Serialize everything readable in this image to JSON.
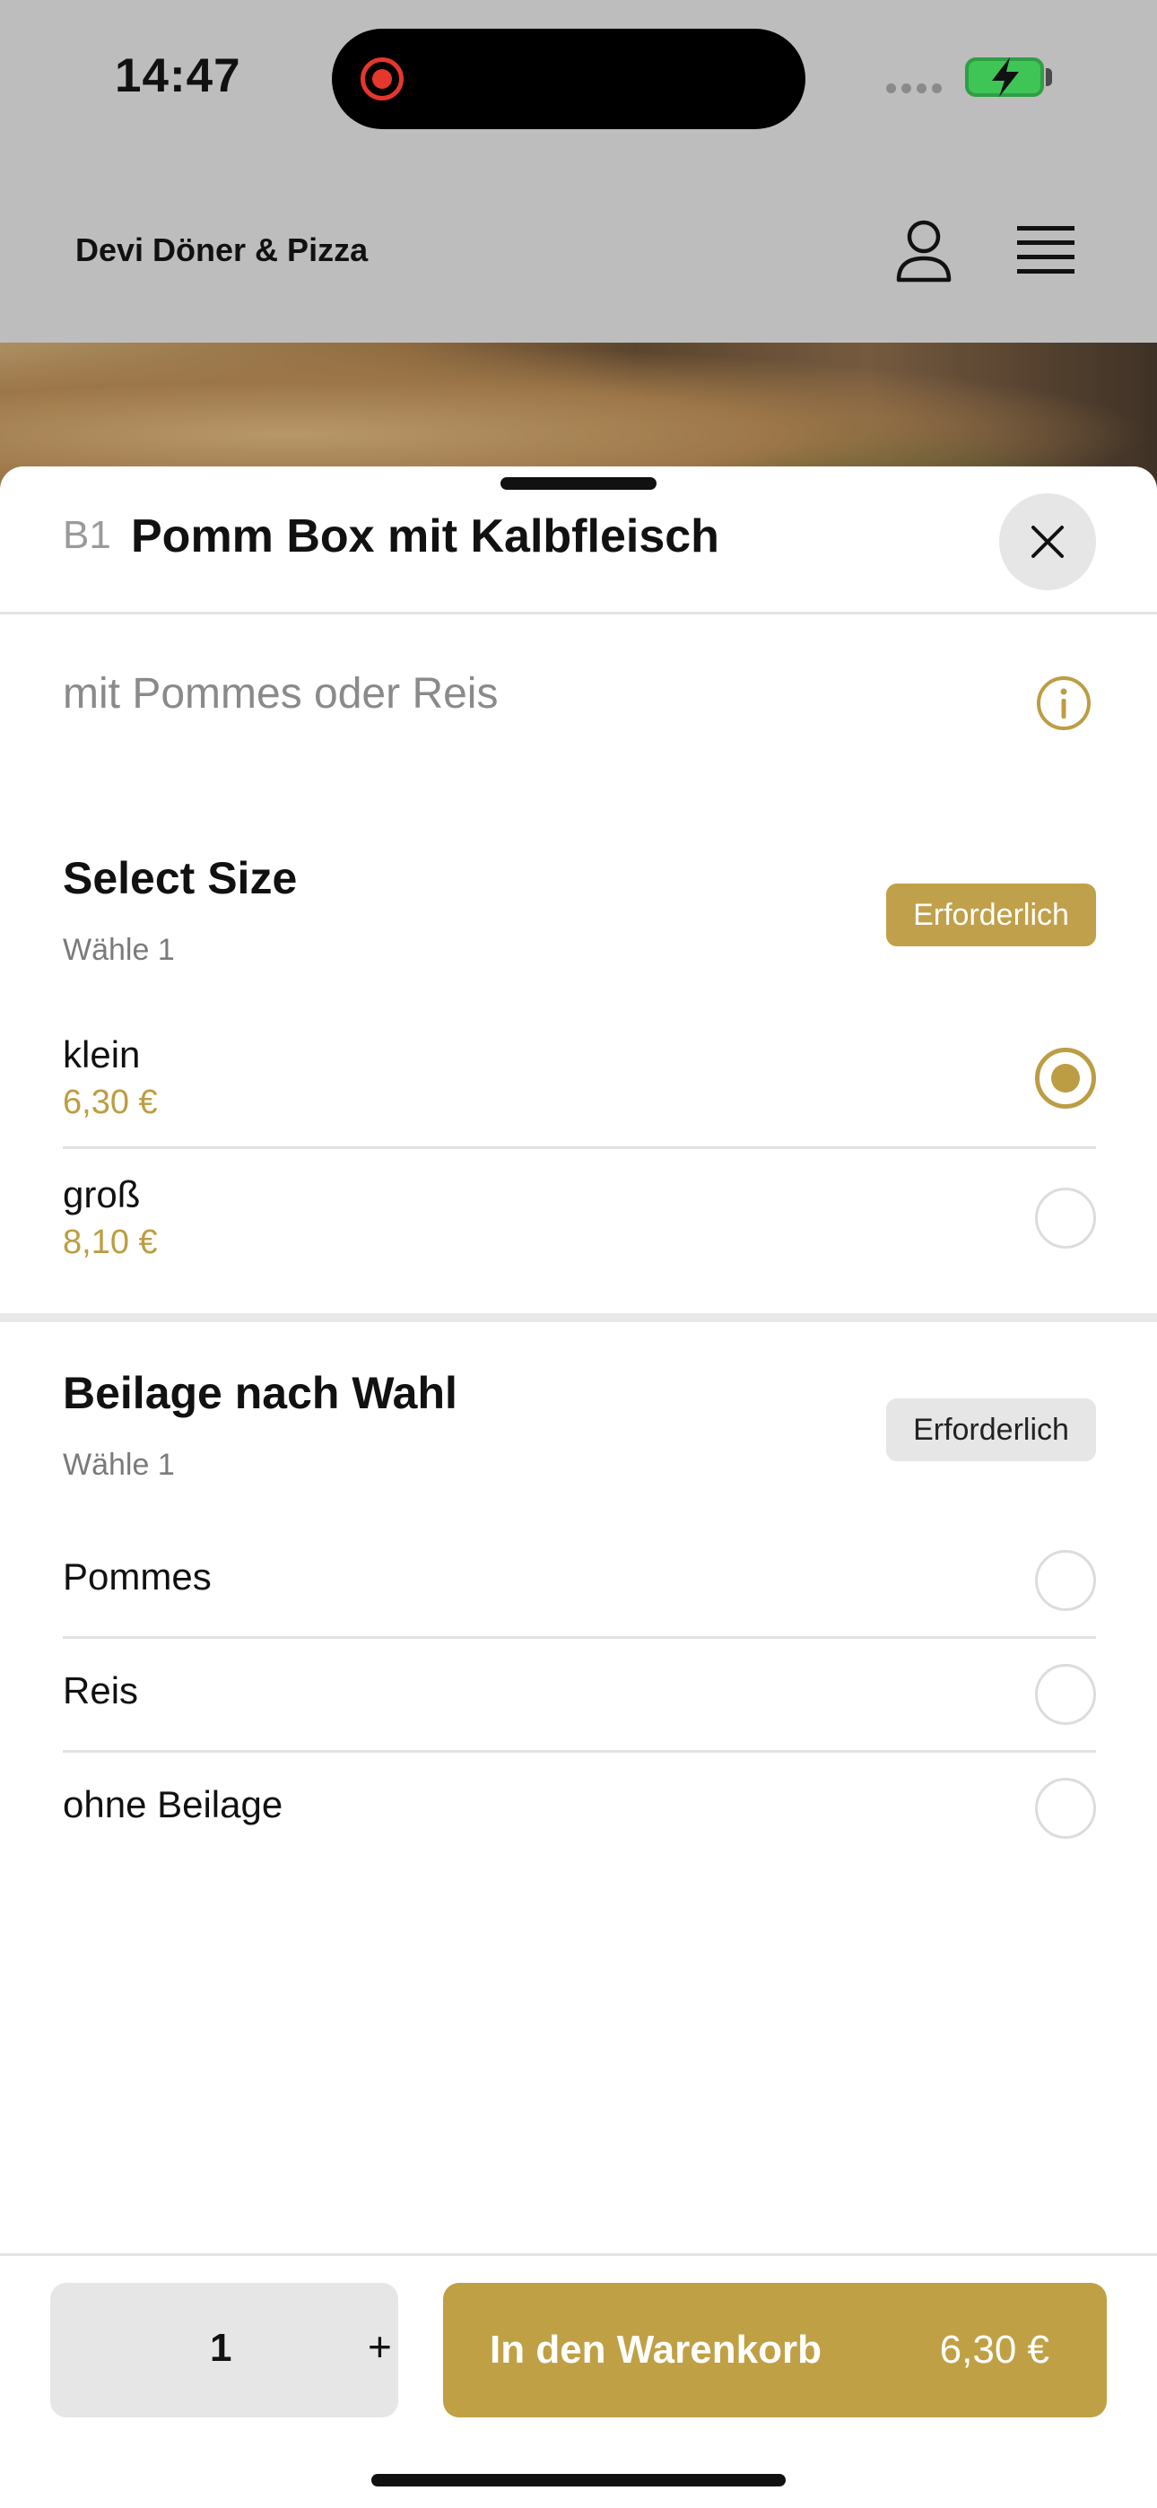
{
  "status_bar": {
    "time": "14:47"
  },
  "header": {
    "brand": "Devi Döner & Pizza"
  },
  "item": {
    "code": "B1",
    "title": "Pomm Box mit Kalbfleisch",
    "description": "mit Pommes oder Reis"
  },
  "groups": [
    {
      "title": "Select Size",
      "subtitle": "Wähle 1",
      "badge": "Erforderlich",
      "options": [
        {
          "label": "klein",
          "price": "6,30 €",
          "selected": true
        },
        {
          "label": "groß",
          "price": "8,10 €",
          "selected": false
        }
      ]
    },
    {
      "title": "Beilage nach Wahl",
      "subtitle": "Wähle 1",
      "badge": "Erforderlich",
      "options": [
        {
          "label": "Pommes",
          "selected": false
        },
        {
          "label": "Reis",
          "selected": false
        },
        {
          "label": "ohne Beilage",
          "selected": false
        }
      ]
    }
  ],
  "footer": {
    "quantity": "1",
    "plus": "+",
    "cart_label": "In den Warenkorb",
    "cart_price": "6,30 €"
  },
  "colors": {
    "accent": "#bfa044",
    "badge_inactive": "#e6e6e6"
  },
  "icons": [
    "record-icon",
    "signal-icon",
    "battery-icon",
    "user-icon",
    "menu-icon",
    "close-icon",
    "info-icon"
  ]
}
